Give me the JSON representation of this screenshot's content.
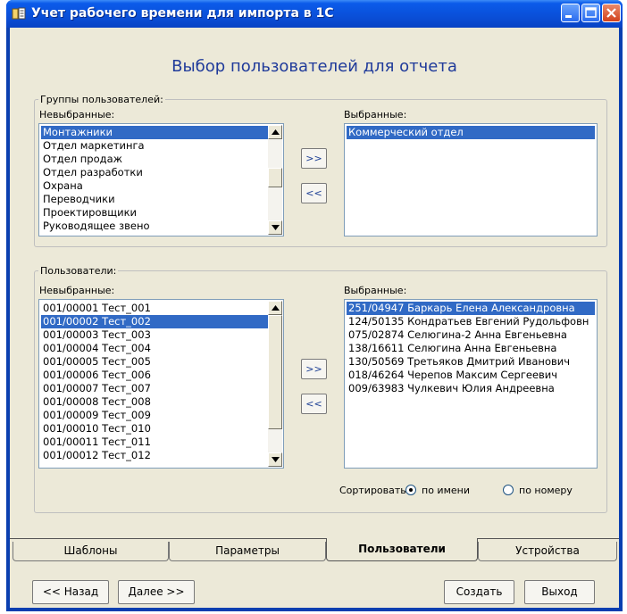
{
  "window": {
    "title": "Учет рабочего времени для импорта в 1С"
  },
  "heading": "Выбор пользователей для отчета",
  "groups": {
    "legend": "Группы пользователей:",
    "unselected_label": "Невыбранные:",
    "selected_label": "Выбранные:",
    "unselected": [
      "Монтажники",
      "Отдел маркетинга",
      "Отдел продаж",
      "Отдел разработки",
      "Охрана",
      "Переводчики",
      "Проектировщики",
      "Руководящее звено"
    ],
    "selected": [
      "Коммерческий отдел"
    ],
    "add_label": ">>",
    "remove_label": "<<"
  },
  "users": {
    "legend": "Пользователи:",
    "unselected_label": "Невыбранные:",
    "selected_label": "Выбранные:",
    "unselected": [
      "001/00001 Тест_001",
      "001/00002 Тест_002",
      "001/00003 Тест_003",
      "001/00004 Тест_004",
      "001/00005 Тест_005",
      "001/00006 Тест_006",
      "001/00007 Тест_007",
      "001/00008 Тест_008",
      "001/00009 Тест_009",
      "001/00010 Тест_010",
      "001/00011 Тест_011",
      "001/00012 Тест_012"
    ],
    "selected": [
      "251/04947 Баркарь Елена Александровна",
      "124/50135 Кондратьев Евгений Рудольфовн",
      "075/02874 Селюгина-2 Анна Евгеньевна",
      "138/16611 Селюгина Анна Евгеньевна",
      "130/50569 Третьяков Дмитрий Иванович",
      "018/46264 Черепов Максим Сергеевич",
      "009/63983 Чулкевич Юлия Андреевна"
    ],
    "add_label": ">>",
    "remove_label": "<<",
    "sort_label": "Сортировать:",
    "sort_by_name": "по имени",
    "sort_by_number": "по номеру",
    "sort_selected": "по имени"
  },
  "tabs": [
    {
      "label": "Шаблоны"
    },
    {
      "label": "Параметры"
    },
    {
      "label": "Пользователи"
    },
    {
      "label": "Устройства"
    }
  ],
  "active_tab": "Пользователи",
  "footer": {
    "back": "<< Назад",
    "next": "Далее >>",
    "create": "Создать",
    "exit": "Выход"
  },
  "colors": {
    "title_bar": "#0a4fd8",
    "heading": "#1f3a9a",
    "selection": "#316ac5",
    "client": "#ece9d8"
  }
}
